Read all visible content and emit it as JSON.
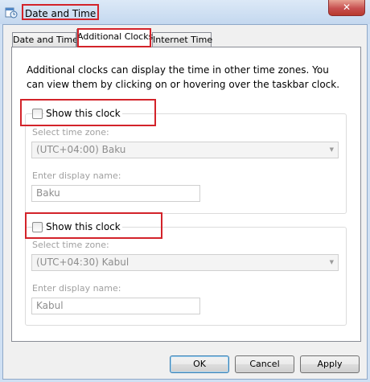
{
  "window": {
    "title": "Date and Time",
    "close_glyph": "✕",
    "icon": "clock-calendar-icon"
  },
  "tabs": [
    {
      "label": "Date and Time",
      "active": false
    },
    {
      "label": "Additional Clocks",
      "active": true
    },
    {
      "label": "Internet Time",
      "active": false
    }
  ],
  "description": "Additional clocks can display the time in other time zones. You can view them by clicking on or hovering over the taskbar clock.",
  "clocks": [
    {
      "show_label": "Show this clock",
      "checked": false,
      "timezone_label": "Select time zone:",
      "timezone_value": "(UTC+04:00) Baku",
      "name_label": "Enter display name:",
      "name_value": "Baku"
    },
    {
      "show_label": "Show this clock",
      "checked": false,
      "timezone_label": "Select time zone:",
      "timezone_value": "(UTC+04:30) Kabul",
      "name_label": "Enter display name:",
      "name_value": "Kabul"
    }
  ],
  "buttons": {
    "ok": "OK",
    "cancel": "Cancel",
    "apply": "Apply"
  },
  "highlight_color": "#d3232a"
}
